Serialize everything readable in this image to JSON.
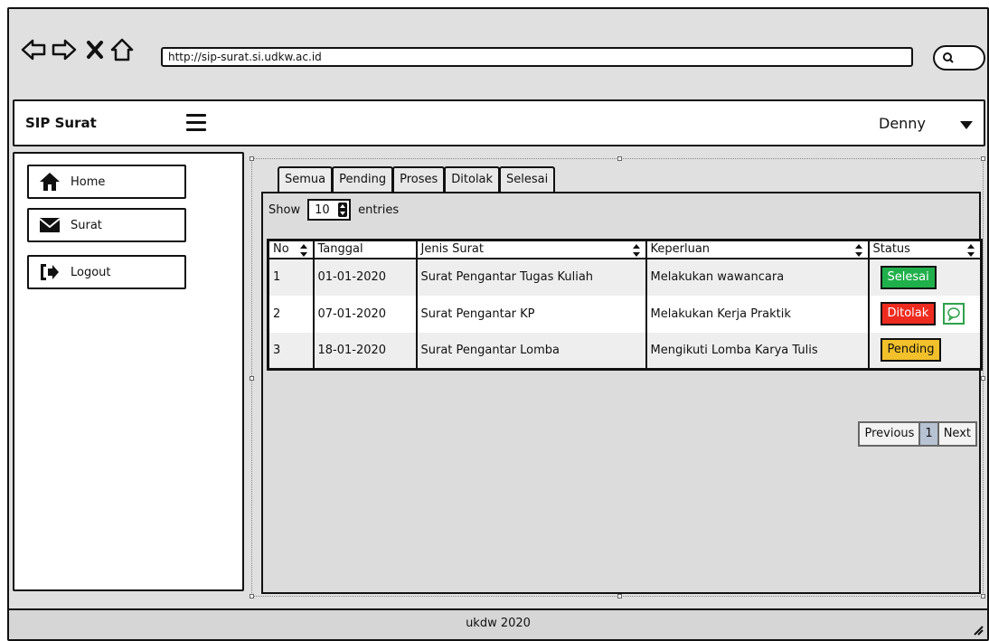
{
  "browser": {
    "url": "http://sip-surat.si.udkw.ac.id",
    "nav_icons": [
      "back-arrow-icon",
      "forward-arrow-icon",
      "close-icon",
      "home-icon"
    ]
  },
  "header": {
    "brand": "SIP Surat",
    "user": "Denny"
  },
  "sidebar": {
    "items": [
      {
        "label": "Home",
        "icon": "home-icon"
      },
      {
        "label": "Surat",
        "icon": "envelope-icon"
      },
      {
        "label": "Logout",
        "icon": "logout-icon"
      }
    ]
  },
  "tabs": [
    "Semua",
    "Pending",
    "Proses",
    "Ditolak",
    "Selesai"
  ],
  "entries": {
    "show_label": "Show",
    "value": "10",
    "suffix": "entries"
  },
  "table": {
    "columns": [
      "No",
      "Tanggal",
      "Jenis Surat",
      "Keperluan",
      "Status"
    ],
    "rows": [
      {
        "no": "1",
        "tanggal": "01-01-2020",
        "jenis": "Surat Pengantar Tugas Kuliah",
        "keperluan": "Melakukan wawancara",
        "status": "Selesai"
      },
      {
        "no": "2",
        "tanggal": "07-01-2020",
        "jenis": "Surat Pengantar KP",
        "keperluan": "Melakukan Kerja Praktik",
        "status": "Ditolak"
      },
      {
        "no": "3",
        "tanggal": "18-01-2020",
        "jenis": "Surat Pengantar Lomba",
        "keperluan": "Mengikuti Lomba Karya Tulis",
        "status": "Pending"
      }
    ]
  },
  "status_colors": {
    "Selesai": "#20b04b",
    "Ditolak": "#ee2b1f",
    "Pending": "#f2c02a"
  },
  "pagination": {
    "previous": "Previous",
    "page": "1",
    "next": "Next"
  },
  "footer": "ukdw 2020"
}
